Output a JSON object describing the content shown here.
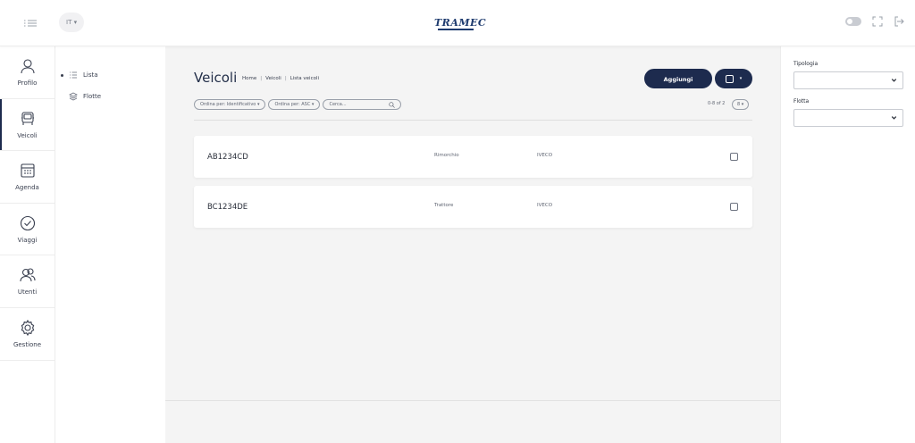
{
  "topbar": {
    "language": "IT",
    "logo_text": "TRAMEC",
    "icons": [
      "menu-icon",
      "theme-toggle-icon",
      "fullscreen-icon",
      "logout-icon"
    ]
  },
  "rail": {
    "items": [
      {
        "label": "Profilo",
        "icon": "user-icon"
      },
      {
        "label": "Veicoli",
        "icon": "vehicle-icon"
      },
      {
        "label": "Agenda",
        "icon": "calendar-icon"
      },
      {
        "label": "Viaggi",
        "icon": "check-circle-icon"
      },
      {
        "label": "Utenti",
        "icon": "users-icon"
      },
      {
        "label": "Gestione",
        "icon": "gear-icon"
      }
    ],
    "active": "Veicoli"
  },
  "subnav": {
    "items": [
      {
        "label": "Lista",
        "icon": "list-icon"
      },
      {
        "label": "Flotte",
        "icon": "layers-icon"
      }
    ]
  },
  "main": {
    "title": "Veicoli",
    "breadcrumb": [
      "Home",
      "Veicoli",
      "Lista veicoli"
    ],
    "add_button": "Aggiungi",
    "filters": {
      "order_by_field": "Ordina per: Identificativo",
      "order_by_dir": "Ordina per: ASC",
      "search_placeholder": "Cerca..."
    },
    "count_text": "0-8 of 2",
    "per_page": "8",
    "rows": [
      {
        "plate": "AB1234CD",
        "type": "Rimorchio",
        "brand": "IVECO"
      },
      {
        "plate": "BC1234DE",
        "type": "Trattore",
        "brand": "IVECO"
      }
    ]
  },
  "right_panel": {
    "tipologia_label": "Tipologia",
    "tipologia_value": "",
    "flotta_label": "Flotta",
    "flotta_value": ""
  },
  "colors": {
    "accent": "#1d2b4e",
    "background": "#f4f4f4"
  }
}
